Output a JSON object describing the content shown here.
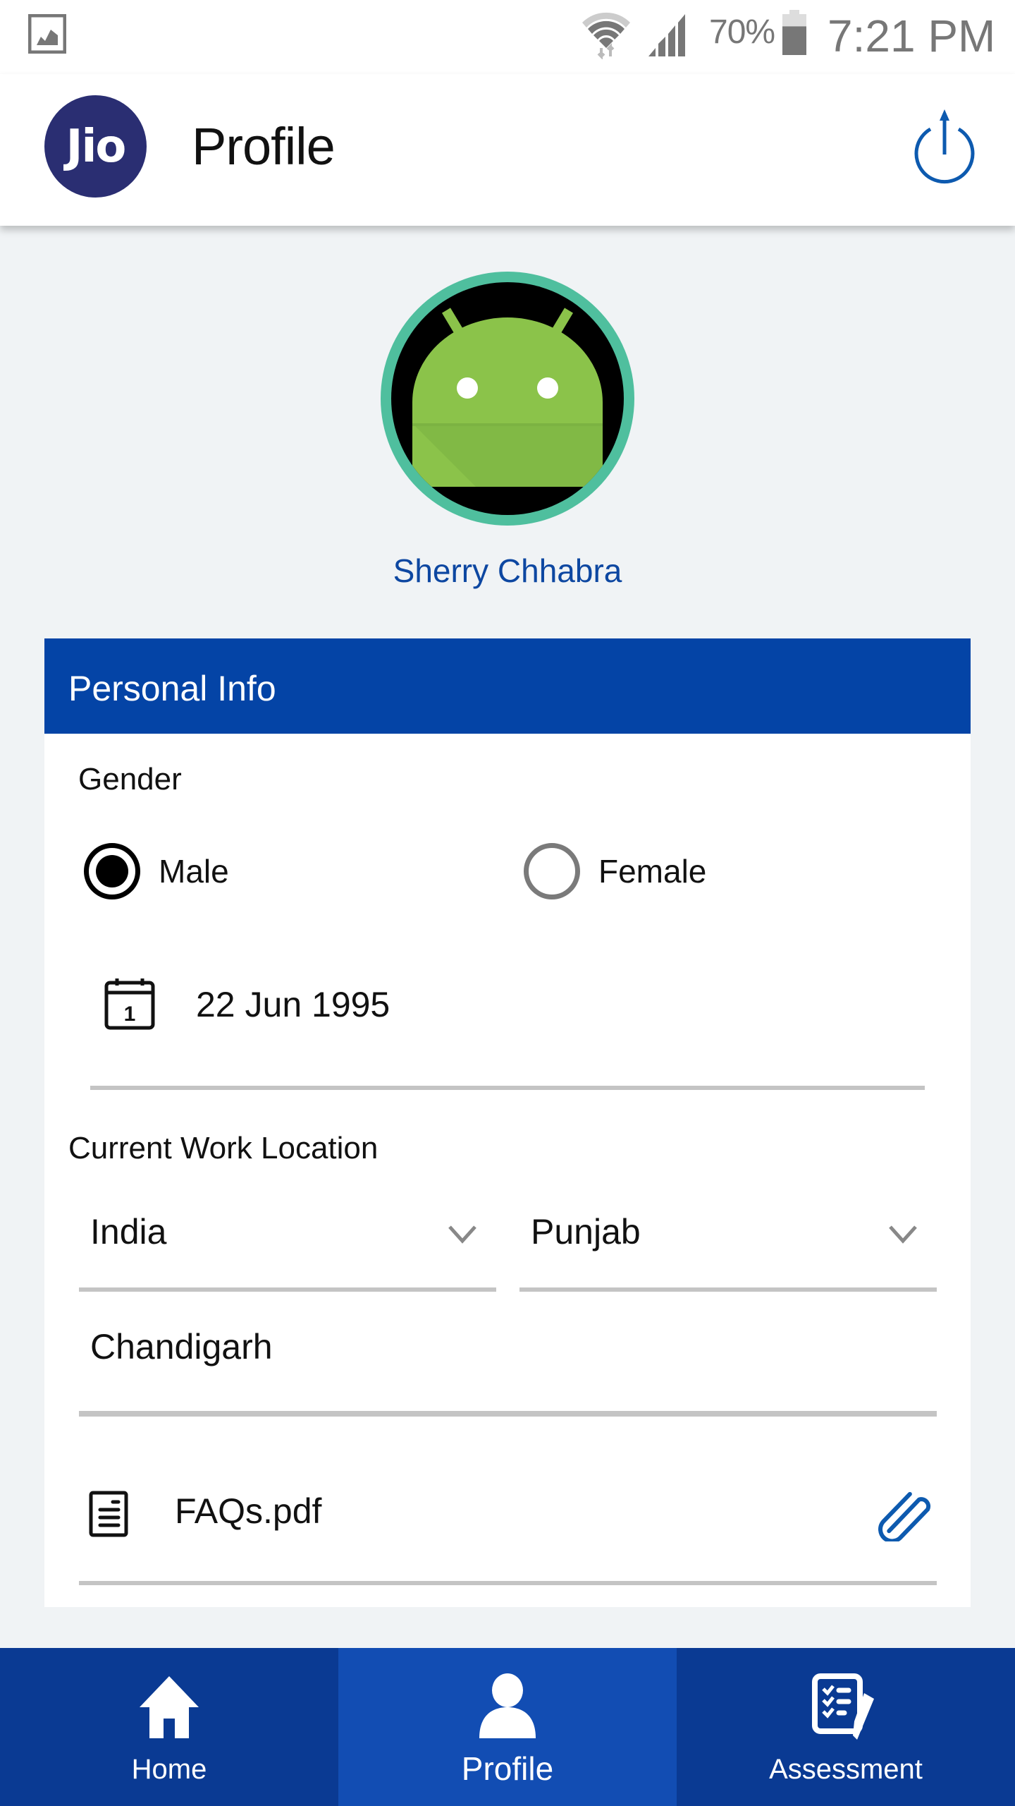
{
  "status_bar": {
    "notification_icon": "gallery-icon",
    "wifi_icon": "wifi-icon",
    "signal_icon": "signal-icon",
    "battery_percent": "70%",
    "battery_level": 0.7,
    "battery_icon": "battery-icon",
    "time": "7:21 PM"
  },
  "app_bar": {
    "logo_text": "Jio",
    "title": "Profile",
    "action_icon": "power-icon"
  },
  "profile": {
    "avatar_icon": "android-icon",
    "name": "Sherry Chhabra"
  },
  "personal_info": {
    "header": "Personal Info",
    "gender": {
      "label": "Gender",
      "options": [
        {
          "label": "Male",
          "selected": true
        },
        {
          "label": "Female",
          "selected": false
        }
      ]
    },
    "date_of_birth": {
      "icon": "calendar-icon",
      "value": "22 Jun 1995"
    },
    "work_location": {
      "label": "Current Work Location",
      "country": "India",
      "state": "Punjab",
      "city": "Chandigarh"
    },
    "attachment": {
      "icon": "document-icon",
      "file_name": "FAQs.pdf",
      "action_icon": "paperclip-icon"
    }
  },
  "bottom_nav": {
    "items": [
      {
        "label": "Home",
        "icon": "home-icon",
        "active": false
      },
      {
        "label": "Profile",
        "icon": "person-icon",
        "active": true
      },
      {
        "label": "Assessment",
        "icon": "assessment-icon",
        "active": false
      }
    ]
  },
  "colors": {
    "brand_blue": "#0444A6",
    "nav_bg": "#0A3A93",
    "nav_active": "#124DB3",
    "logo_bg": "#2A2E72",
    "avatar_ring": "#4FBF9E",
    "name_text": "#0D47A1",
    "page_bg": "#F0F3F5"
  }
}
